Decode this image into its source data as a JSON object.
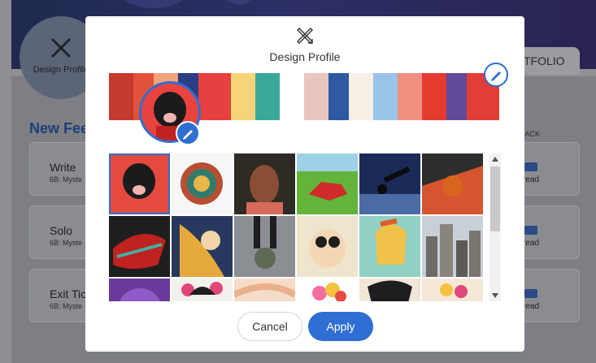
{
  "background": {
    "avatar_label": "Design Profile",
    "tab_label": "TFOLIO",
    "heading": "New Fee",
    "column_header": "DBACK",
    "cards": [
      {
        "title": "Write",
        "subtitle": "6B: Myste",
        "status": "read"
      },
      {
        "title": "Solo",
        "subtitle": "6B: Myste",
        "status": "read"
      },
      {
        "title": "Exit Tic",
        "subtitle": "6B: Myste",
        "status": "read"
      }
    ]
  },
  "modal": {
    "title": "Design Profile",
    "header_icon": "design-tools-icon",
    "cancel_label": "Cancel",
    "apply_label": "Apply",
    "accent_color": "#2f6ed2",
    "gallery": [
      "red-dog-portrait",
      "colored-pencils",
      "woman-illustration",
      "red-creature-on-grass",
      "telescope-silhouette",
      "basketball",
      "abstract-bird-art",
      "golden-woman-art",
      "soccer-ball-feet",
      "cartoon-dog-glasses",
      "spartan-warrior-art",
      "city-skyline",
      "purple-circle",
      "woman-with-flowers",
      "pastel-abstract",
      "flower-bouquet",
      "dark-hair-woman",
      "flowers-and-ball"
    ]
  }
}
